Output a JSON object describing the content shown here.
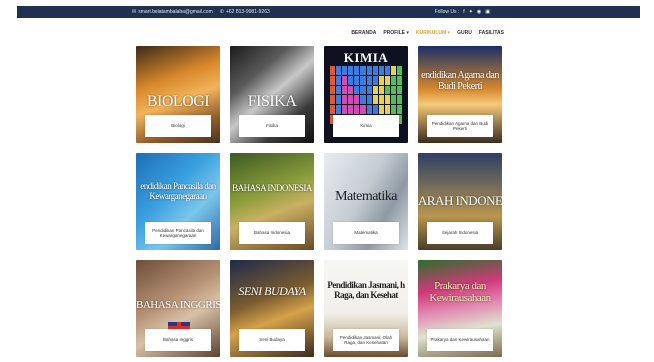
{
  "topbar": {
    "email": "smart.belatambalaba@gmail.com",
    "phone": "+62 813-9981-9263",
    "follow_label": "Follow Us :",
    "social_icons": [
      "facebook-icon",
      "twitter-icon",
      "instagram-icon",
      "linkedin-icon"
    ],
    "background_color": "#1f3050"
  },
  "nav": {
    "items": [
      {
        "label": "BERANDA"
      },
      {
        "label": "PROFILE ▾"
      },
      {
        "label": "KURIKULUM ▾"
      },
      {
        "label": "GURU"
      },
      {
        "label": "FASILITAS"
      }
    ],
    "active_color": "#e8a52b"
  },
  "subjects": [
    {
      "banner": "BIOLOGI",
      "label": "Biologi"
    },
    {
      "banner": "FISIKA",
      "label": "Fisika"
    },
    {
      "banner": "KIMIA",
      "label": "Kimia"
    },
    {
      "banner": "endidikan Agama dan Budi Pekerti",
      "label": "Pendidikan Agama dan Budi Pekerti"
    },
    {
      "banner": "endidikan Pancasila dan Kewarganegaraan",
      "label": "Pendidikan Pancasila dan Kewarganegaraan"
    },
    {
      "banner": "BAHASA INDONESIA",
      "label": "Bahasa Indonesia"
    },
    {
      "banner": "Matematika",
      "label": "Matematika"
    },
    {
      "banner": "ARAH INDONE",
      "label": "Sejarah Indonesia"
    },
    {
      "banner": "BAHASA INGGRIS",
      "label": "Bahasa Inggris"
    },
    {
      "banner": "SENI BUDAYA",
      "label": "Seni Budaya"
    },
    {
      "banner": "Pendidikan Jasmani, h Raga, dan Kesehat",
      "label": "Pendidikan Jasmani, Olah Raga, dan Kesehatan"
    },
    {
      "banner": "Prakarya dan Kewirausahaan",
      "label": "Prakarya dan Kewirausahaan"
    }
  ]
}
